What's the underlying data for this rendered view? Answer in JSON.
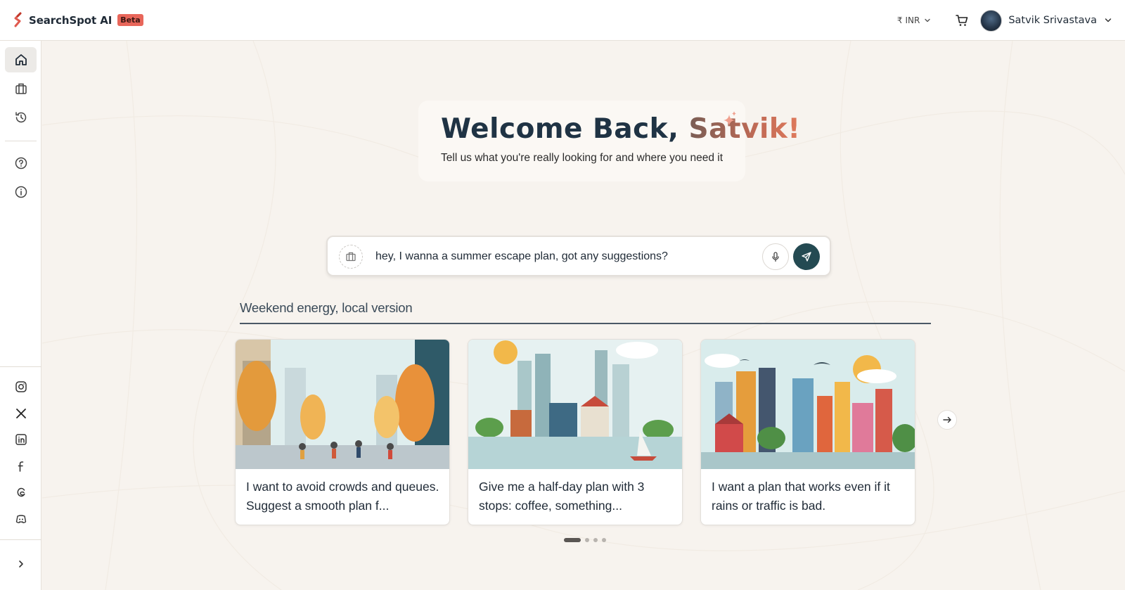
{
  "brand": {
    "name": "SearchSpot AI",
    "badge": "Beta"
  },
  "header": {
    "currency_symbol": "₹",
    "currency_code": "INR",
    "user_name": "Satvik Srivastava"
  },
  "sidebar": {
    "items": [
      {
        "name": "home",
        "active": true
      },
      {
        "name": "trips",
        "active": false
      },
      {
        "name": "history",
        "active": false
      },
      {
        "name": "help",
        "active": false
      },
      {
        "name": "info",
        "active": false
      }
    ],
    "socials": [
      "instagram",
      "x",
      "linkedin",
      "facebook",
      "threads",
      "discord"
    ]
  },
  "welcome": {
    "title_prefix": "Welcome Back, ",
    "title_name": "Satvik!",
    "subtitle": "Tell us what you're really looking for and where you need it"
  },
  "search": {
    "value": "hey, I wanna a summer escape plan, got any suggestions?"
  },
  "section": {
    "title": "Weekend energy, local version"
  },
  "cards": [
    {
      "text": "I want to avoid crowds and queues. Suggest a smooth plan f..."
    },
    {
      "text": "Give me a half-day plan with 3 stops: coffee, something..."
    },
    {
      "text": "I want a plan that works even if it rains or traffic is bad."
    }
  ],
  "carousel": {
    "current_page": 1,
    "total_pages": 4
  },
  "colors": {
    "accent": "#244a52",
    "beta_badge": "#e8665a",
    "background": "#f7f3ee"
  }
}
